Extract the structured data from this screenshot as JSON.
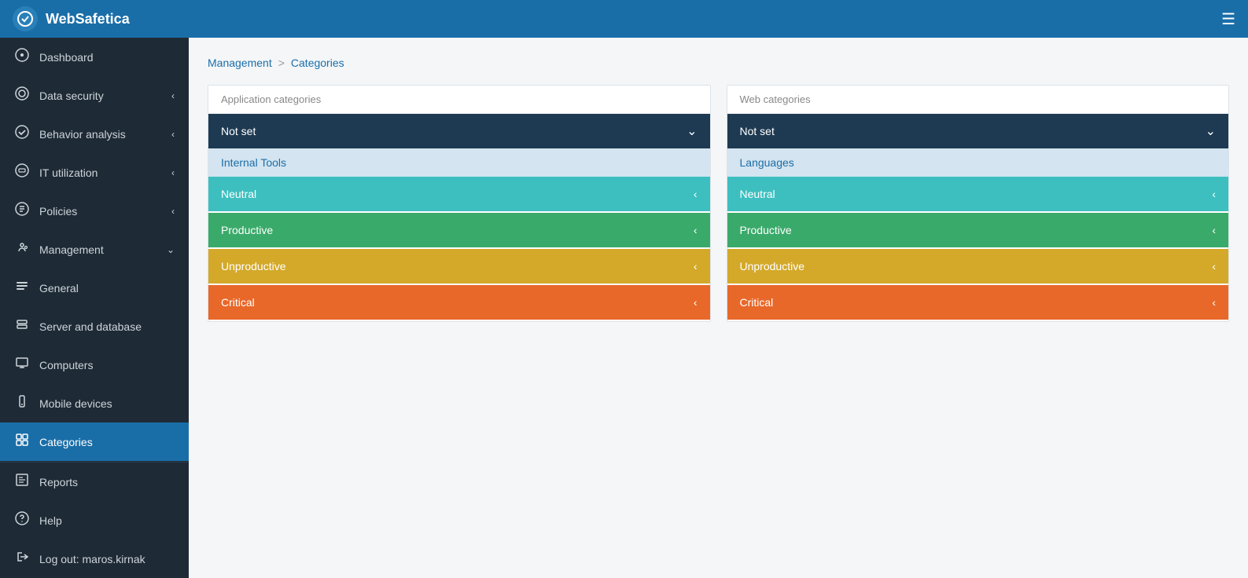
{
  "app": {
    "name": "WebSafetica",
    "logoIcon": "W"
  },
  "sidebar": {
    "items": [
      {
        "id": "dashboard",
        "label": "Dashboard",
        "icon": "⊙",
        "hasArrow": false,
        "active": false
      },
      {
        "id": "data-security",
        "label": "Data security",
        "icon": "⊛",
        "hasArrow": true,
        "active": false
      },
      {
        "id": "behavior-analysis",
        "label": "Behavior analysis",
        "icon": "✓",
        "hasArrow": true,
        "active": false
      },
      {
        "id": "it-utilization",
        "label": "IT utilization",
        "icon": "☰",
        "hasArrow": true,
        "active": false
      },
      {
        "id": "policies",
        "label": "Policies",
        "icon": "⊜",
        "hasArrow": true,
        "active": false
      },
      {
        "id": "management",
        "label": "Management",
        "icon": "⚙",
        "hasArrow": true,
        "active": false,
        "arrowDown": true
      },
      {
        "id": "general",
        "label": "General",
        "icon": "≡",
        "hasArrow": false,
        "active": false
      },
      {
        "id": "server-and-database",
        "label": "Server and database",
        "icon": "▣",
        "hasArrow": false,
        "active": false
      },
      {
        "id": "computers",
        "label": "Computers",
        "icon": "□",
        "hasArrow": false,
        "active": false
      },
      {
        "id": "mobile-devices",
        "label": "Mobile devices",
        "icon": "▯",
        "hasArrow": false,
        "active": false
      },
      {
        "id": "categories",
        "label": "Categories",
        "icon": "⊟",
        "hasArrow": false,
        "active": true
      }
    ],
    "bottomItems": [
      {
        "id": "reports",
        "label": "Reports",
        "icon": "⊞",
        "hasArrow": false,
        "active": false
      },
      {
        "id": "help",
        "label": "Help",
        "icon": "?",
        "hasArrow": false,
        "active": false
      },
      {
        "id": "logout",
        "label": "Log out: maros.kirnak",
        "icon": "⎋",
        "hasArrow": false,
        "active": false
      }
    ]
  },
  "breadcrumb": {
    "parent": "Management",
    "current": "Categories",
    "separator": ">"
  },
  "appCategoriesPanel": {
    "header": "Application categories",
    "dropdown": {
      "label": "Not set",
      "selectedItem": "Internal Tools"
    },
    "categories": [
      {
        "id": "neutral",
        "label": "Neutral",
        "colorClass": "cat-neutral"
      },
      {
        "id": "productive",
        "label": "Productive",
        "colorClass": "cat-productive"
      },
      {
        "id": "unproductive",
        "label": "Unproductive",
        "colorClass": "cat-unproductive"
      },
      {
        "id": "critical",
        "label": "Critical",
        "colorClass": "cat-critical"
      }
    ]
  },
  "webCategoriesPanel": {
    "header": "Web categories",
    "dropdown": {
      "label": "Not set",
      "selectedItem": "Languages"
    },
    "categories": [
      {
        "id": "neutral",
        "label": "Neutral",
        "colorClass": "cat-neutral"
      },
      {
        "id": "productive",
        "label": "Productive",
        "colorClass": "cat-productive"
      },
      {
        "id": "unproductive",
        "label": "Unproductive",
        "colorClass": "cat-unproductive"
      },
      {
        "id": "critical",
        "label": "Critical",
        "colorClass": "cat-critical"
      }
    ]
  }
}
